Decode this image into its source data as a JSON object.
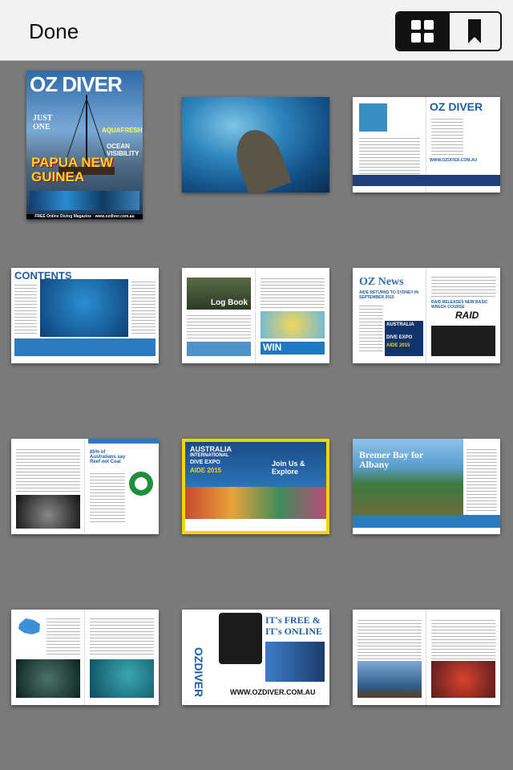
{
  "toolbar": {
    "done_label": "Done",
    "view_modes": [
      {
        "icon": "grid-icon",
        "selected": true
      },
      {
        "icon": "bookmark-icon",
        "selected": false
      }
    ]
  },
  "colors": {
    "toolbar_bg": "#f2f2f2",
    "grid_bg": "#7b7b7b",
    "selected_border": "#f2d600"
  },
  "pages": {
    "cover": {
      "masthead": "OZ DIVER",
      "headline": "PAPUA NEW GUINEA",
      "side_texts": [
        "JUST ONE",
        "AQUAFRESH",
        "OCEAN VISIBILITY"
      ],
      "footer": "FREE Online Diving Magazine · www.ozdiver.com.au"
    },
    "p3": {
      "masthead": "OZ DIVER",
      "url": "WWW.OZDIVER.COM.AU"
    },
    "p4": {
      "heading": "CONTENTS"
    },
    "p5": {
      "photo_caption": "Log Book",
      "banner": "WIN"
    },
    "p6": {
      "heading": "OZ News",
      "subhead": "AIDE RETURNS TO SYDNEY IN SEPTEMBER 2015",
      "subhead2": "RAID RELEASES NEW BASIC WRECK COURSE",
      "logo": "RAID",
      "ad_lines": [
        "AUSTRALIA",
        "INTERNATIONAL",
        "DIVE EXPO",
        "AIDE 2015"
      ]
    },
    "p7": {
      "heading": "85% of Australians say Reef not Coal"
    },
    "p8": {
      "lines": [
        "AUSTRALIA",
        "INTERNATIONAL",
        "DIVE EXPO",
        "AIDE 2015"
      ],
      "cta": "Join Us & Explore"
    },
    "p9": {
      "heading": "Bremer Bay for Albany"
    },
    "p11": {
      "headline1": "IT's FREE &",
      "headline2": "IT's ONLINE",
      "side": "OZDIVER",
      "url": "WWW.OZDIVER.COM.AU"
    }
  }
}
